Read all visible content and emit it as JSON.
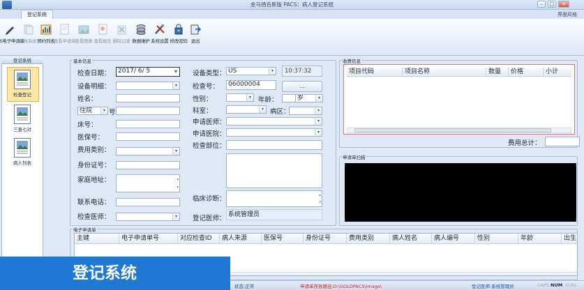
{
  "window": {
    "title": "金马扬名新版 PACS：病人登记系统",
    "tab": "登记系统",
    "layout_style": "界面风格"
  },
  "toolbar": {
    "items": [
      {
        "label": "HIS电子申请单",
        "icon": "pen-icon",
        "enabled": true
      },
      {
        "label": "记账系统",
        "icon": "documents-icon",
        "enabled": false
      },
      {
        "label": "预约列表",
        "icon": "chart-list-icon",
        "enabled": true
      },
      {
        "label": "查看申请单",
        "icon": "form-icon",
        "enabled": false
      },
      {
        "label": "查看图像",
        "icon": "image-icon",
        "enabled": false
      },
      {
        "label": "查看报告",
        "icon": "report-icon",
        "enabled": false
      },
      {
        "label": "删除记录",
        "icon": "delete-icon",
        "enabled": false
      },
      {
        "label": "数据维护",
        "icon": "database-icon",
        "enabled": true
      },
      {
        "label": "系统设置",
        "icon": "tools-icon",
        "enabled": true
      },
      {
        "label": "修改密码",
        "icon": "key-lock-icon",
        "enabled": true
      },
      {
        "label": "退出",
        "icon": "exit-icon",
        "enabled": true
      }
    ]
  },
  "nav": {
    "header": "登记系统",
    "items": [
      {
        "label": "检查登记",
        "icon": "register-icon",
        "selected": true
      },
      {
        "label": "三查七对",
        "icon": "checklist-icon",
        "selected": false
      },
      {
        "label": "病人列表",
        "icon": "patient-list-icon",
        "selected": false
      }
    ]
  },
  "basic_info": {
    "group_label": "基本信息",
    "check_date_label": "检查日期：",
    "check_date_value": "2017/ 6/ 5",
    "device_detail_label": "设备明细：",
    "name_label": "姓名：",
    "inpatient_value": "住院",
    "number_suffix": "号",
    "bed_label": "床号：",
    "insurance_label": "医保号：",
    "fee_type_label": "费用类别：",
    "id_card_label": "身份证号：",
    "address_label": "家庭地址：",
    "phone_label": "联系电话：",
    "doctor_label": "检查医师：",
    "device_type_label": "设备类型：",
    "device_type_value": "US",
    "time_value": "10:37:32",
    "exam_no_label": "检查号：",
    "exam_no_value": "06000004",
    "more_button": "...",
    "gender_label": "性别：",
    "age_label": "年龄：",
    "age_unit": "岁",
    "dept_label": "科室：",
    "ward_label": "病区：",
    "apply_doctor_label": "申请医师：",
    "apply_hospital_label": "申请医院：",
    "exam_part_label": "检查部位：",
    "diagnosis_label": "临床诊断：",
    "register_doctor_label": "登记医师：",
    "register_doctor_value": "系统管理员"
  },
  "fee_info": {
    "group_label": "收费信息",
    "columns": [
      "项目代码",
      "项目名称",
      "数量",
      "价格",
      "小计"
    ],
    "total_label": "费用总计："
  },
  "scan": {
    "group_label": "申请单扫描"
  },
  "e_apply": {
    "group_label": "电子申请单",
    "columns": [
      "主键",
      "电子申请单号",
      "对应检查ID",
      "病人来源",
      "医保号",
      "身份证号",
      "费用类别",
      "病人姓名",
      "病人编号",
      "性别",
      "年龄",
      "出生"
    ]
  },
  "statusbar": {
    "status": "状态:正常",
    "path": "申请单存放路径:D:\\GOLDPACS\\Image\\",
    "user": "登记医师:系统管理员",
    "caps": "CAPS",
    "num": "NUM",
    "scrl": "SCRL"
  },
  "banner": {
    "text": "登记系统"
  },
  "colors": {
    "banner": "#1f78d4",
    "fee_border": "#e06a7a",
    "status_red": "#d4252b",
    "status_blue": "#1f4fa8"
  }
}
